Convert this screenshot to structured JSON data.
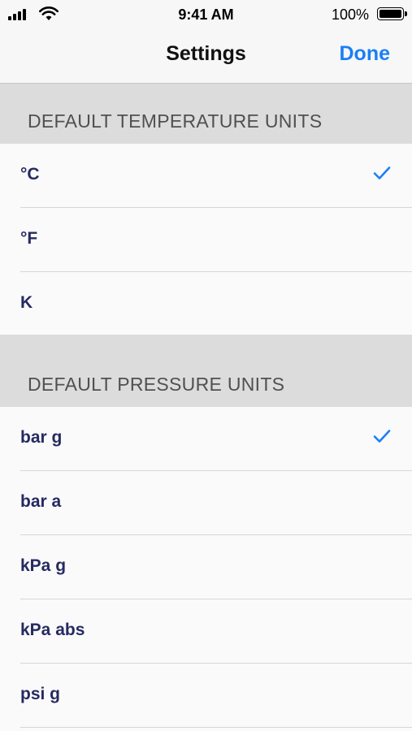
{
  "status_bar": {
    "time": "9:41 AM",
    "battery_percent": "100%",
    "signal_icon": "cellular-signal-icon",
    "wifi_icon": "wifi-icon",
    "battery_icon": "battery-full-icon"
  },
  "nav": {
    "title": "Settings",
    "done_label": "Done"
  },
  "colors": {
    "accent": "#1a7ff5",
    "row_text": "#262a62",
    "section_bg": "#dcdcdc"
  },
  "temperature": {
    "header": "DEFAULT TEMPERATURE UNITS",
    "items": [
      {
        "label": "°C",
        "selected": true
      },
      {
        "label": "°F",
        "selected": false
      },
      {
        "label": "K",
        "selected": false
      }
    ]
  },
  "pressure": {
    "header": "DEFAULT PRESSURE UNITS",
    "items": [
      {
        "label": "bar g",
        "selected": true
      },
      {
        "label": "bar a",
        "selected": false
      },
      {
        "label": "kPa g",
        "selected": false
      },
      {
        "label": "kPa abs",
        "selected": false
      },
      {
        "label": "psi g",
        "selected": false
      }
    ]
  }
}
